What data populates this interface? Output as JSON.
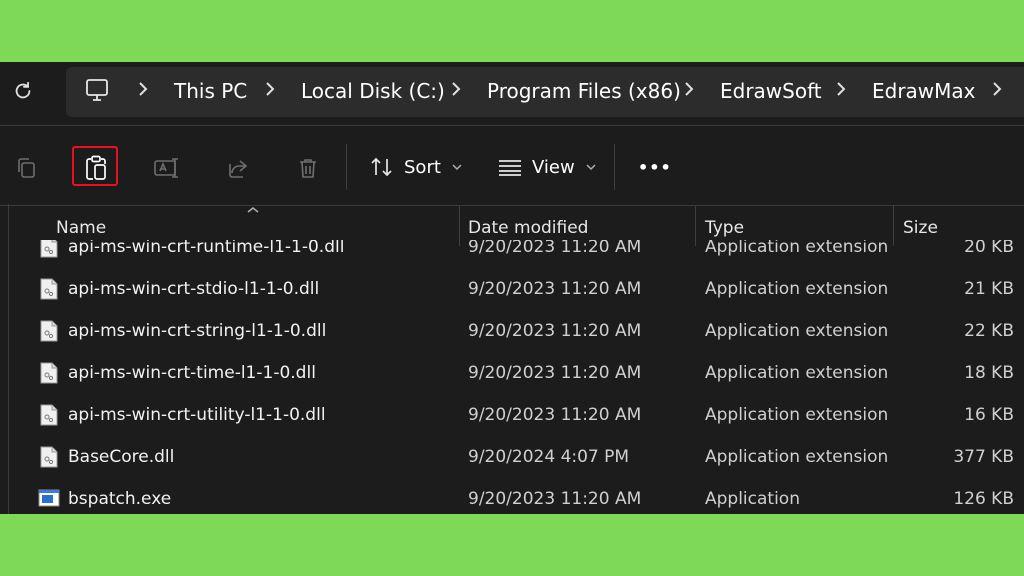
{
  "address_bar": {
    "breadcrumbs": [
      "This PC",
      "Local Disk (C:)",
      "Program Files (x86)",
      "EdrawSoft",
      "EdrawMax"
    ]
  },
  "toolbar": {
    "sort_label": "Sort",
    "view_label": "View",
    "more_label": "•••"
  },
  "columns": {
    "name": "Name",
    "date": "Date modified",
    "type": "Type",
    "size": "Size"
  },
  "files": [
    {
      "name": "api-ms-win-crt-runtime-l1-1-0.dll",
      "date": "9/20/2023 11:20 AM",
      "type": "Application extension",
      "size": "20 KB",
      "icon": "dll-file-icon"
    },
    {
      "name": "api-ms-win-crt-stdio-l1-1-0.dll",
      "date": "9/20/2023 11:20 AM",
      "type": "Application extension",
      "size": "21 KB",
      "icon": "dll-file-icon"
    },
    {
      "name": "api-ms-win-crt-string-l1-1-0.dll",
      "date": "9/20/2023 11:20 AM",
      "type": "Application extension",
      "size": "22 KB",
      "icon": "dll-file-icon"
    },
    {
      "name": "api-ms-win-crt-time-l1-1-0.dll",
      "date": "9/20/2023 11:20 AM",
      "type": "Application extension",
      "size": "18 KB",
      "icon": "dll-file-icon"
    },
    {
      "name": "api-ms-win-crt-utility-l1-1-0.dll",
      "date": "9/20/2023 11:20 AM",
      "type": "Application extension",
      "size": "16 KB",
      "icon": "dll-file-icon"
    },
    {
      "name": "BaseCore.dll",
      "date": "9/20/2024 4:07 PM",
      "type": "Application extension",
      "size": "377 KB",
      "icon": "dll-file-icon"
    },
    {
      "name": "bspatch.exe",
      "date": "9/20/2023 11:20 AM",
      "type": "Application",
      "size": "126 KB",
      "icon": "exe-file-icon"
    }
  ],
  "colors": {
    "background_frame": "#7ed957",
    "window_bg": "#1c1c1c",
    "highlight": "#e81123"
  }
}
